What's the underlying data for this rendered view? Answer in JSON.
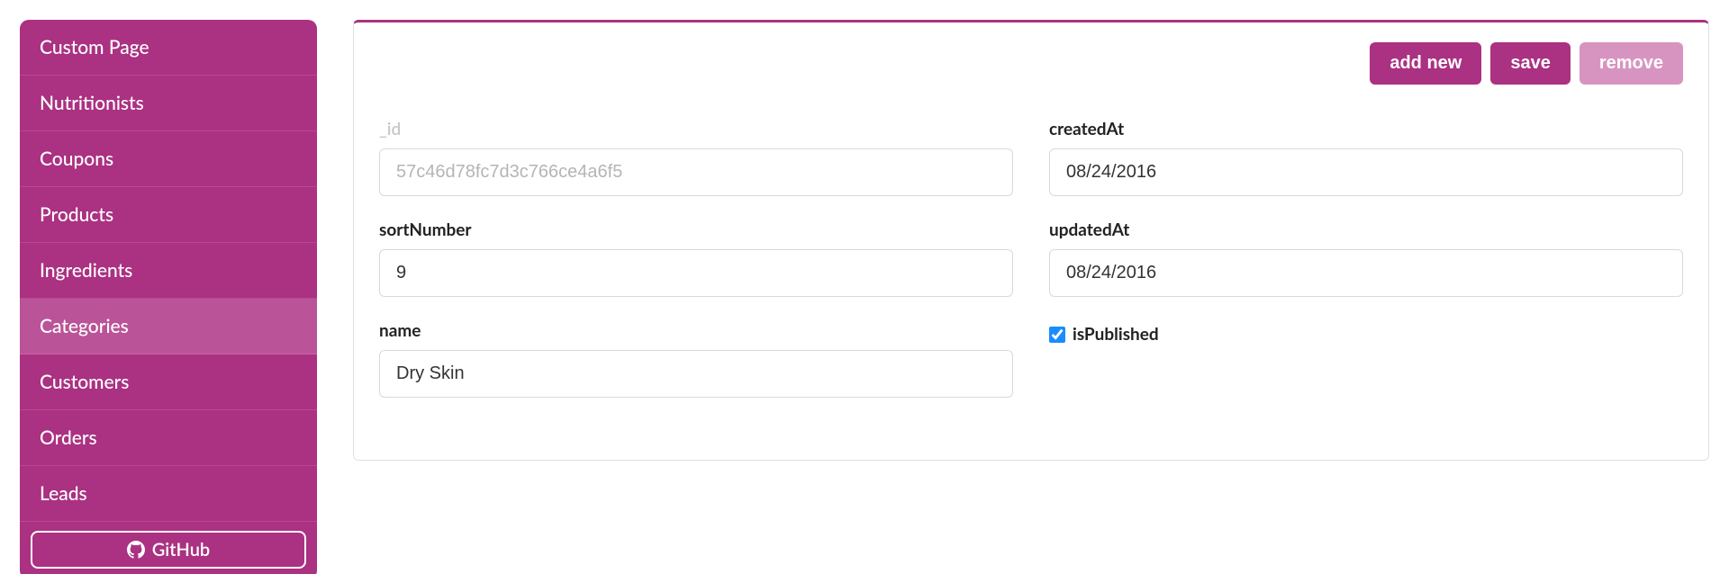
{
  "sidebar": {
    "items": [
      {
        "label": "Custom Page",
        "active": false
      },
      {
        "label": "Nutritionists",
        "active": false
      },
      {
        "label": "Coupons",
        "active": false
      },
      {
        "label": "Products",
        "active": false
      },
      {
        "label": "Ingredients",
        "active": false
      },
      {
        "label": "Categories",
        "active": true
      },
      {
        "label": "Customers",
        "active": false
      },
      {
        "label": "Orders",
        "active": false
      },
      {
        "label": "Leads",
        "active": false
      }
    ],
    "github_label": "GitHub"
  },
  "actions": {
    "add_new": "add new",
    "save": "save",
    "remove": "remove"
  },
  "form": {
    "id_label": "_id",
    "id_value": "57c46d78fc7d3c766ce4a6f5",
    "sortNumber_label": "sortNumber",
    "sortNumber_value": "9",
    "name_label": "name",
    "name_value": "Dry Skin",
    "createdAt_label": "createdAt",
    "createdAt_value": "08/24/2016",
    "updatedAt_label": "updatedAt",
    "updatedAt_value": "08/24/2016",
    "isPublished_label": "isPublished",
    "isPublished_checked": true
  }
}
